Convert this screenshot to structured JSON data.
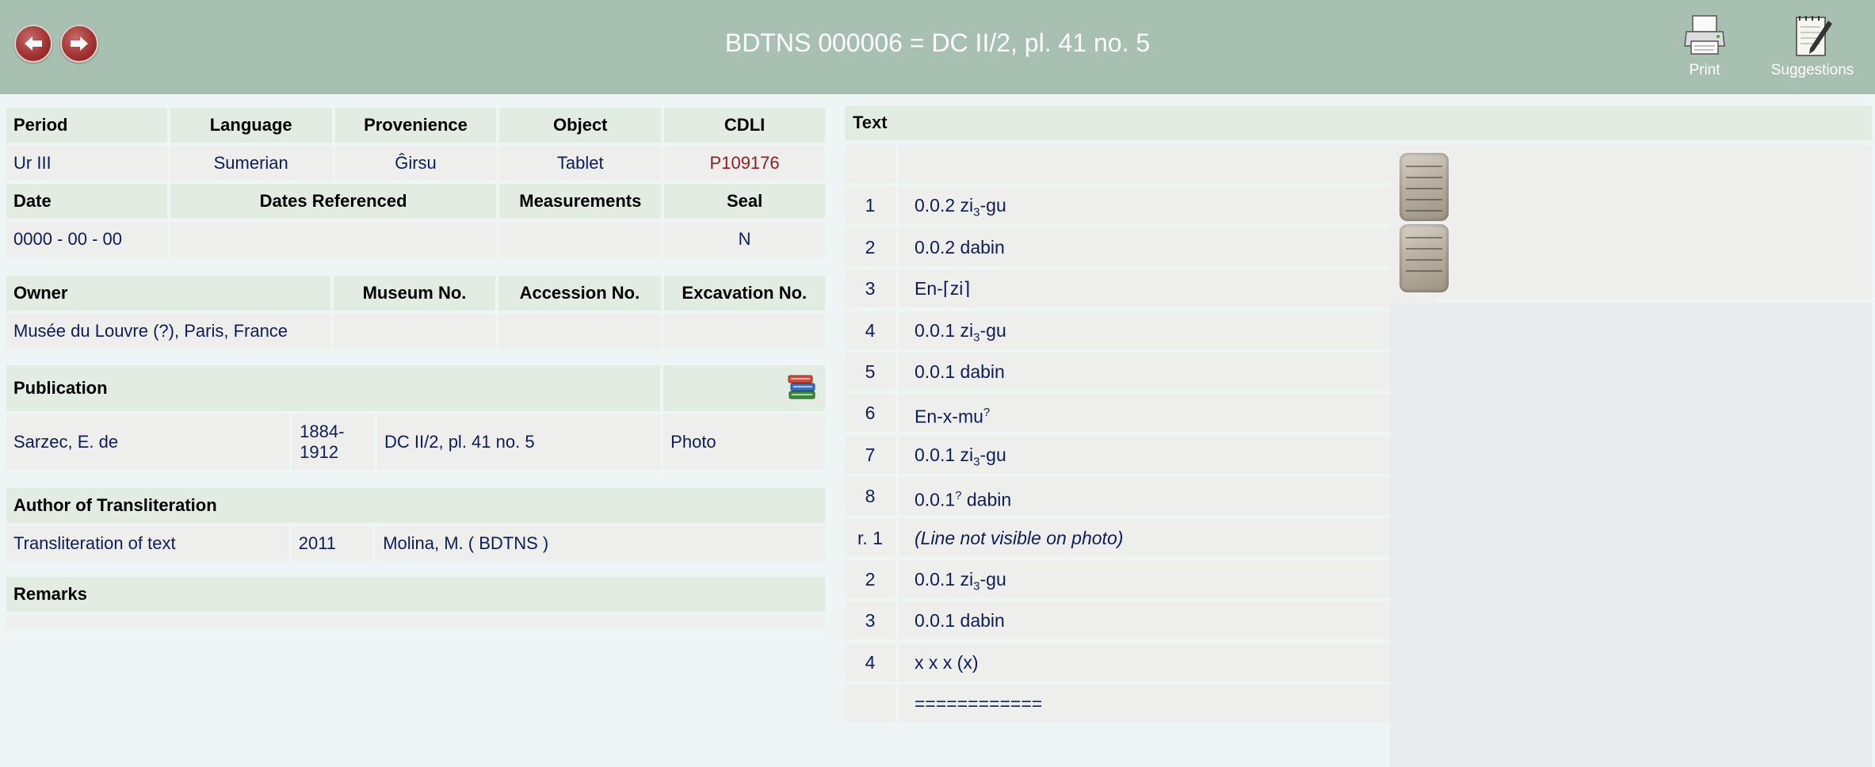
{
  "header": {
    "title": "BDTNS 000006 = DC II/2, pl. 41 no. 5",
    "print_label": "Print",
    "suggestions_label": "Suggestions"
  },
  "info": {
    "period_h": "Period",
    "language_h": "Language",
    "provenience_h": "Provenience",
    "object_h": "Object",
    "cdli_h": "CDLI",
    "period": "Ur III",
    "language": "Sumerian",
    "provenience": "Ĝirsu",
    "object": "Tablet",
    "cdli": "P109176",
    "date_h": "Date",
    "dates_ref_h": "Dates Referenced",
    "measurements_h": "Measurements",
    "seal_h": "Seal",
    "date": "0000 - 00 - 00",
    "seal": "N",
    "owner_h": "Owner",
    "museum_h": "Museum No.",
    "accession_h": "Accession No.",
    "excavation_h": "Excavation No.",
    "owner": "Musée du Louvre (?), Paris, France",
    "publication_h": "Publication",
    "pub_author": "Sarzec, E. de",
    "pub_years": "1884-1912",
    "pub_ref": "DC II/2, pl. 41 no. 5",
    "pub_photo": "Photo",
    "author_h": "Author of Transliteration",
    "translit": "Transliteration of text",
    "translit_year": "2011",
    "translit_author": "Molina, M. ( BDTNS )",
    "remarks_h": "Remarks"
  },
  "text_panel": {
    "heading": "Text",
    "lines": [
      {
        "n": "",
        "pre": "",
        "sub": "",
        "sup": "",
        "post": ""
      },
      {
        "n": "1",
        "pre": "0.0.2 zi",
        "sub": "3",
        "sup": "",
        "post": "-gu"
      },
      {
        "n": "2",
        "pre": "0.0.2 dabin",
        "sub": "",
        "sup": "",
        "post": ""
      },
      {
        "n": "3",
        "pre": "En-⌈zi⌉",
        "sub": "",
        "sup": "",
        "post": ""
      },
      {
        "n": "4",
        "pre": "0.0.1 zi",
        "sub": "3",
        "sup": "",
        "post": "-gu"
      },
      {
        "n": "5",
        "pre": "0.0.1 dabin",
        "sub": "",
        "sup": "",
        "post": ""
      },
      {
        "n": "6",
        "pre": "En-x-mu",
        "sub": "",
        "sup": "?",
        "post": ""
      },
      {
        "n": "7",
        "pre": "0.0.1 zi",
        "sub": "3",
        "sup": "",
        "post": "-gu"
      },
      {
        "n": "8",
        "pre": "0.0.1",
        "sub": "",
        "sup": "?",
        "post": " dabin"
      },
      {
        "n": "r. 1",
        "pre": "(Line not visible on photo)",
        "sub": "",
        "sup": "",
        "post": "",
        "italic": true
      },
      {
        "n": "2",
        "pre": "0.0.1 zi",
        "sub": "3",
        "sup": "",
        "post": "-gu"
      },
      {
        "n": "3",
        "pre": "0.0.1 dabin",
        "sub": "",
        "sup": "",
        "post": ""
      },
      {
        "n": "4",
        "pre": "x x x (x)",
        "sub": "",
        "sup": "",
        "post": ""
      },
      {
        "n": "",
        "pre": "============",
        "sub": "",
        "sup": "",
        "post": ""
      }
    ]
  },
  "icons": {
    "back": "back-arrow-icon",
    "forward": "forward-arrow-icon",
    "print": "printer-icon",
    "suggestions": "notepad-pencil-icon",
    "publication": "books-icon"
  },
  "colors": {
    "header_bg": "#a7c0b1",
    "heading_bg": "#e3ece3",
    "cell_bg": "#eeeeec",
    "value_text": "#0e1d5a",
    "cdli_link": "#8b1f1f"
  }
}
